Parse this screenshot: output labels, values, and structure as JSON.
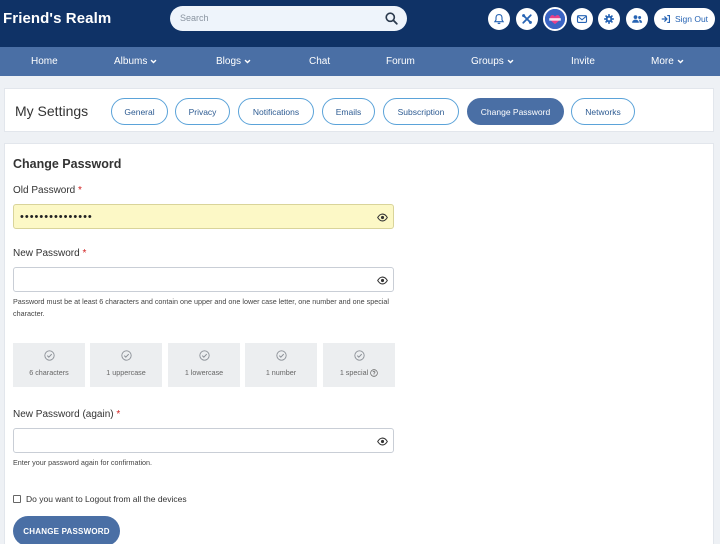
{
  "brand": {
    "title": "Friend's Realm"
  },
  "search": {
    "placeholder": "Search"
  },
  "header": {
    "sign_out_label": "Sign Out"
  },
  "icons": [
    "bell-icon",
    "tools-icon",
    "avatar",
    "envelope-icon",
    "gear-icon",
    "users-icon",
    "sign-out-icon",
    "search-icon"
  ],
  "nav": {
    "items": [
      {
        "label": "Home",
        "dropdown": false
      },
      {
        "label": "Albums",
        "dropdown": true
      },
      {
        "label": "Blogs",
        "dropdown": true
      },
      {
        "label": "Chat",
        "dropdown": false
      },
      {
        "label": "Forum",
        "dropdown": false
      },
      {
        "label": "Groups",
        "dropdown": true
      },
      {
        "label": "Invite",
        "dropdown": false
      },
      {
        "label": "More",
        "dropdown": true
      }
    ]
  },
  "settings": {
    "title": "My Settings",
    "tabs": [
      {
        "label": "General",
        "active": false
      },
      {
        "label": "Privacy",
        "active": false
      },
      {
        "label": "Notifications",
        "active": false
      },
      {
        "label": "Emails",
        "active": false
      },
      {
        "label": "Subscription",
        "active": false
      },
      {
        "label": "Change Password",
        "active": true
      },
      {
        "label": "Networks",
        "active": false
      }
    ]
  },
  "form": {
    "title": "Change Password",
    "old_password": {
      "label": "Old Password",
      "required_mark": "*",
      "value": "•••••••••••••••"
    },
    "new_password": {
      "label": "New Password",
      "required_mark": "*",
      "value": "",
      "help": "Password must be at least 6 characters and contain one upper and one lower case letter, one number and one special character."
    },
    "requirements": [
      {
        "label": "6 characters"
      },
      {
        "label": "1 uppercase"
      },
      {
        "label": "1 lowercase"
      },
      {
        "label": "1 number"
      },
      {
        "label": "1 special"
      }
    ],
    "confirm_password": {
      "label": "New Password (again)",
      "required_mark": "*",
      "value": "",
      "help": "Enter your password again for confirmation."
    },
    "logout_all": {
      "label": "Do you want to Logout from all the devices",
      "checked": false
    },
    "submit_label": "CHANGE PASSWORD"
  },
  "colors": {
    "header": "#0f3266",
    "nav": "#4a6fa5",
    "accent": "#4a6fa5",
    "tab_border": "#5ba3d9",
    "required": "#d12020",
    "autofill": "#fcf8c6"
  }
}
